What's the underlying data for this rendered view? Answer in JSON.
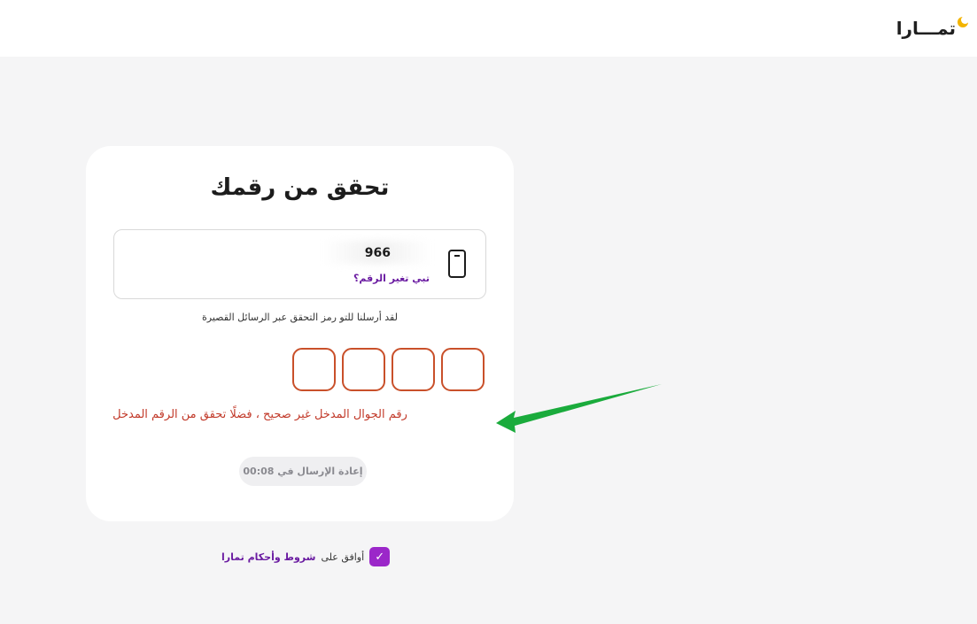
{
  "header": {
    "logo_text": "تمـــارا"
  },
  "card": {
    "title": "تحقق من رقمك",
    "phone_prefix": "966",
    "change_number_link": "تبي تغير الرقم؟",
    "sent_note": "لقد أرسلنا للتو رمز التحقق عبر الرسائل القصيرة",
    "otp_digits": [
      "",
      "",
      "",
      ""
    ],
    "error_message": "رقم الجوال المدخل غير صحيح ، فضلًا تحقق من الرقم المدخل",
    "resend_label": "إعادة الإرسال في 00:08"
  },
  "terms": {
    "checked": true,
    "prefix_text": "أوافق على",
    "link_text": "شروط وأحكام تمارا"
  },
  "colors": {
    "brand_purple": "#9b27c9",
    "link_purple": "#6a1ba1",
    "error_red": "#c23a2a",
    "arrow_green": "#1aab3c"
  }
}
